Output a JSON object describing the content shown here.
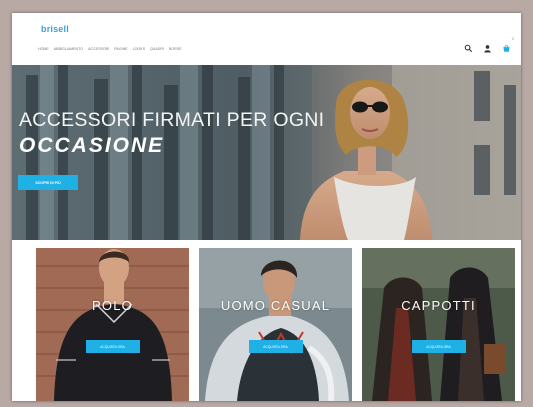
{
  "header": {
    "logo": "brisell",
    "nav": [
      "Home",
      "Abbigliamento",
      "Accessori",
      "Pagine",
      "Looks",
      "Quadri",
      "Borse"
    ],
    "cart_count": "0"
  },
  "hero": {
    "line1": "ACCESSORI FIRMATI PER OGNI",
    "line2": "OCCASIONE",
    "button": "Scopri di più"
  },
  "categories": [
    {
      "title": "POLO",
      "button": "Acquista ora"
    },
    {
      "title": "UOMO CASUAL",
      "button": "Acquista ora"
    },
    {
      "title": "CAPPOTTI",
      "button": "Acquista ora"
    }
  ],
  "colors": {
    "accent": "#1fb0e6",
    "logo": "#3d9fd6",
    "page_background": "#b9a9a5"
  },
  "icons": [
    "search-icon",
    "user-icon",
    "cart-icon"
  ]
}
